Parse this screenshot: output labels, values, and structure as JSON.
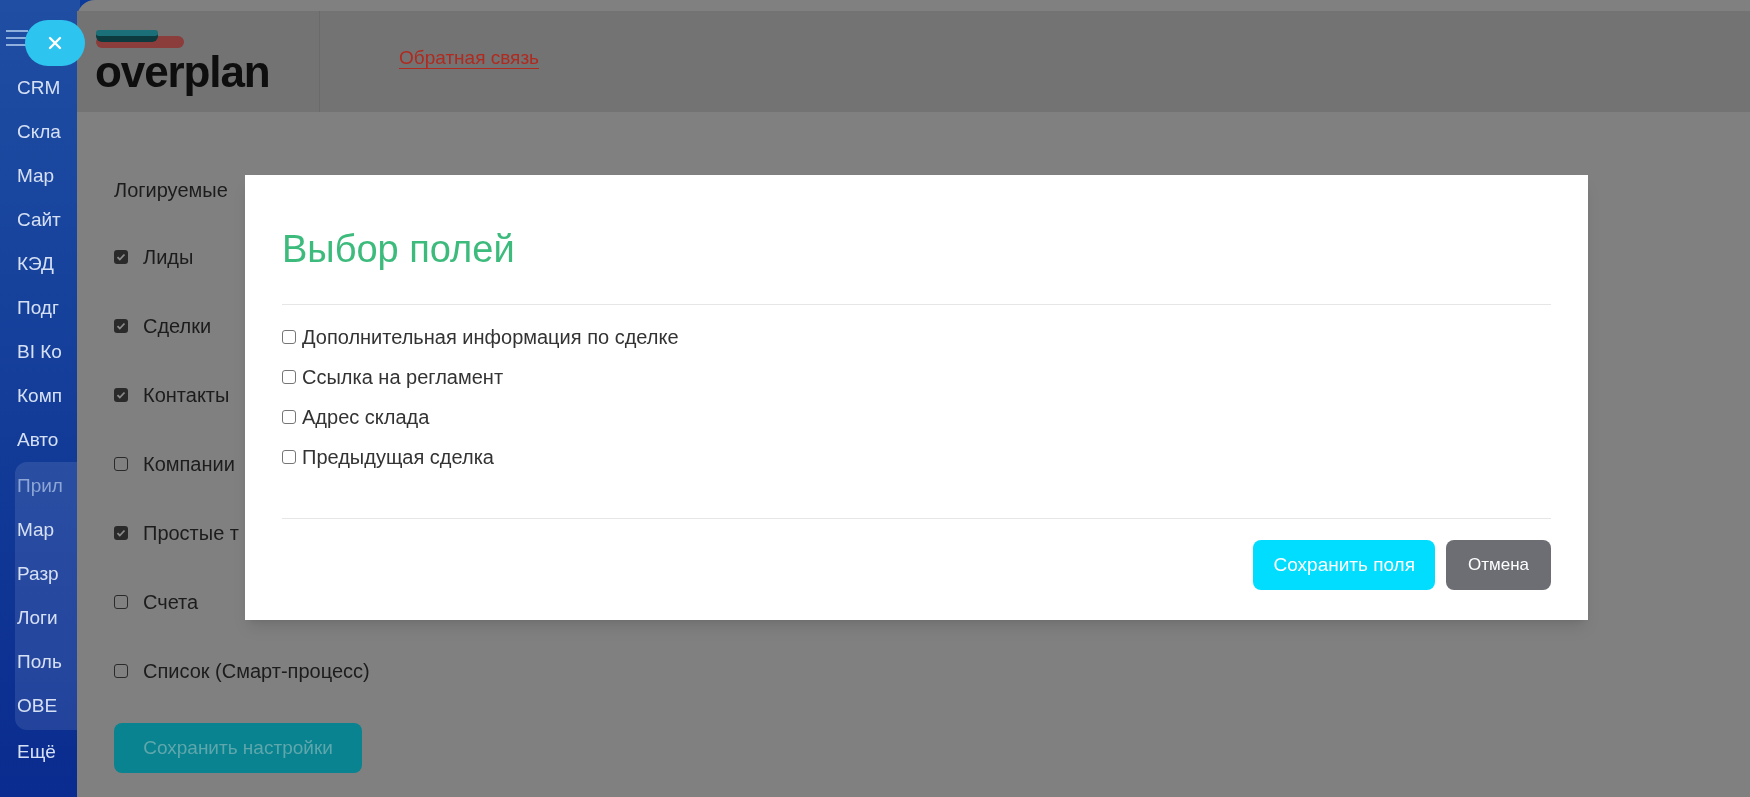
{
  "sidebar": {
    "items": [
      {
        "label": "CRM",
        "kind": "item"
      },
      {
        "label": "Скла",
        "kind": "item"
      },
      {
        "label": "Мар",
        "kind": "item"
      },
      {
        "label": "Сайт",
        "kind": "item"
      },
      {
        "label": "КЭД",
        "kind": "item"
      },
      {
        "label": "Подг",
        "kind": "item"
      },
      {
        "label": "BI Ко",
        "kind": "item"
      },
      {
        "label": "Комп",
        "kind": "item"
      },
      {
        "label": "Авто",
        "kind": "item"
      },
      {
        "label": "Прил",
        "kind": "group-title"
      },
      {
        "label": "Мар",
        "kind": "group-item"
      },
      {
        "label": "Разр",
        "kind": "group-item"
      },
      {
        "label": "Логи",
        "kind": "group-item"
      },
      {
        "label": "Поль",
        "kind": "group-item"
      },
      {
        "label": "ОВЕ",
        "kind": "group-item"
      },
      {
        "label": "Ещё",
        "kind": "item"
      }
    ]
  },
  "header": {
    "logo": "overplan",
    "link": "Обратная связь"
  },
  "settings": {
    "title": "Логируемые",
    "options": [
      {
        "label": "Лиды",
        "checked": true
      },
      {
        "label": "Сделки",
        "checked": true
      },
      {
        "label": "Контакты",
        "checked": true
      },
      {
        "label": "Компании",
        "checked": false
      },
      {
        "label": "Простые т",
        "checked": true
      },
      {
        "label": "Счета",
        "checked": false
      },
      {
        "label": "Список (Смарт-процесс)",
        "checked": false
      }
    ],
    "save_button": "Сохранить настройки"
  },
  "modal": {
    "title": "Выбор полей",
    "fields": [
      {
        "label": "Дополнительная информация по сделке",
        "checked": false
      },
      {
        "label": "Ссылка на регламент",
        "checked": false
      },
      {
        "label": "Адрес склада",
        "checked": false
      },
      {
        "label": "Предыдущая сделка",
        "checked": false
      }
    ],
    "buttons": [
      {
        "label": "Сохранить поля",
        "kind": "primary"
      },
      {
        "label": "Отмена",
        "kind": "secondary"
      }
    ]
  }
}
